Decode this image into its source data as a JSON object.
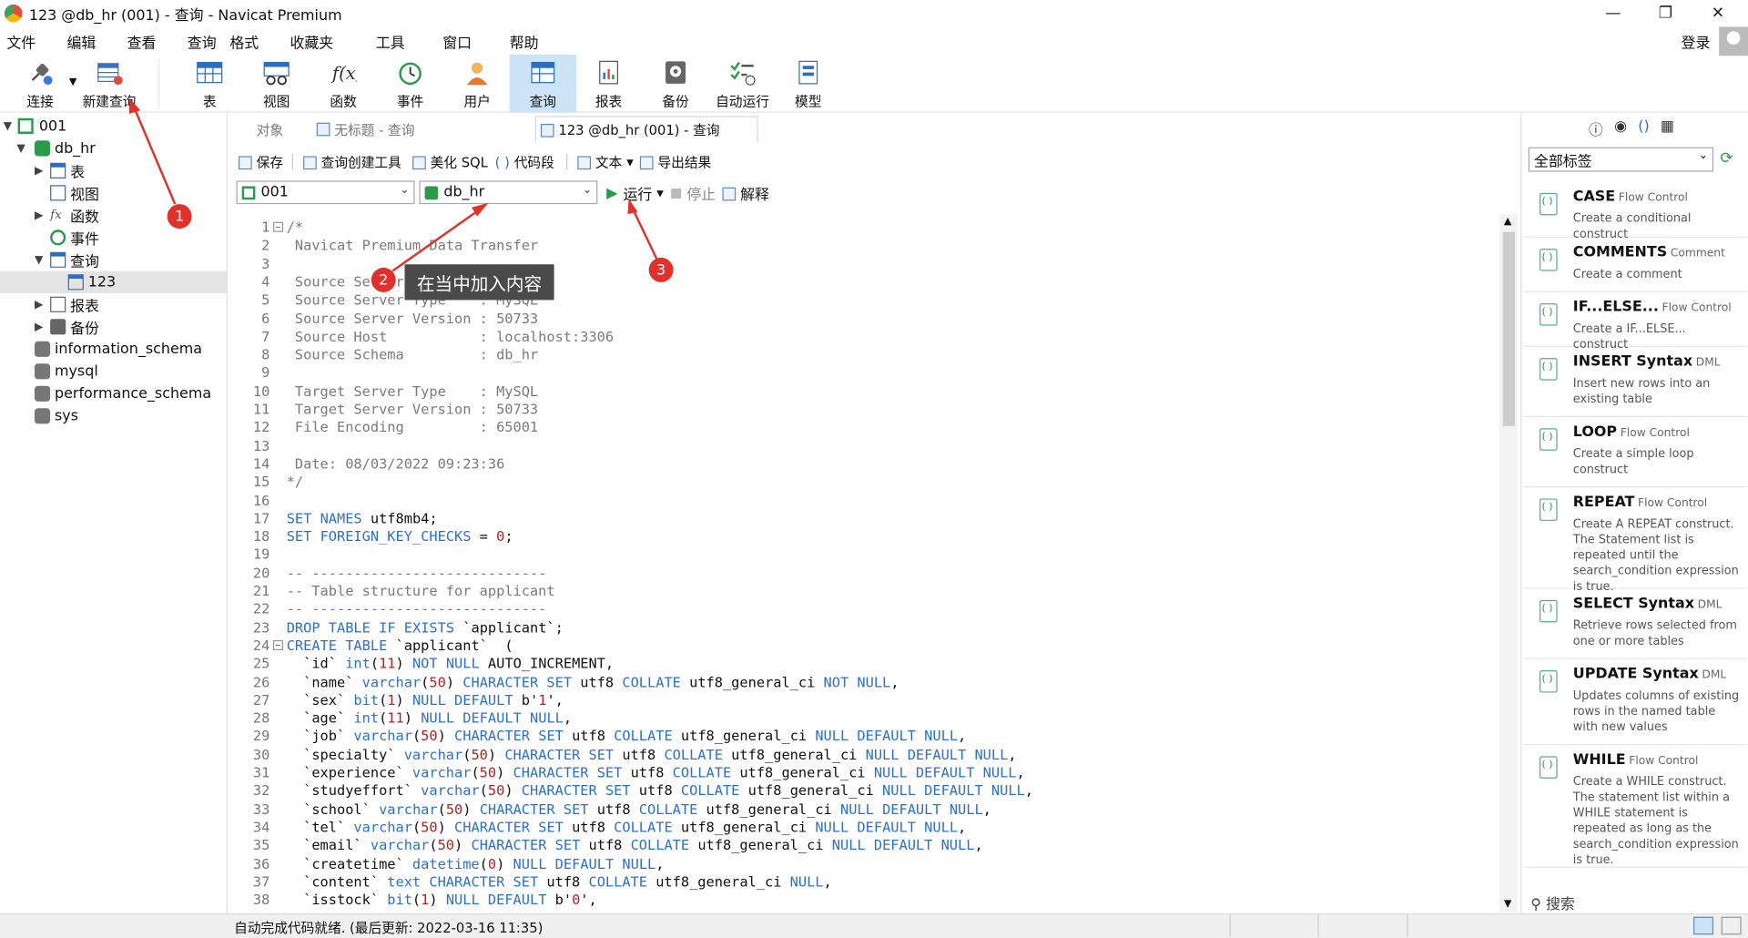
{
  "window": {
    "title": "123 @db_hr (001) - 查询 - Navicat Premium"
  },
  "menu": [
    "文件",
    "编辑",
    "查看",
    "查询",
    "格式",
    "收藏夹",
    "工具",
    "窗口",
    "帮助"
  ],
  "login": "登录",
  "toolbar": {
    "connect": "连接",
    "new_query": "新建查询",
    "table": "表",
    "view": "视图",
    "function": "函数",
    "event": "事件",
    "user": "用户",
    "query": "查询",
    "report": "报表",
    "backup": "备份",
    "automation": "自动运行",
    "model": "模型"
  },
  "tree": {
    "conn": "001",
    "db": "db_hr",
    "tables": "表",
    "views": "视图",
    "functions": "函数",
    "events": "事件",
    "queries": "查询",
    "query_item": "123",
    "reports": "报表",
    "backups": "备份",
    "db2": "information_schema",
    "db3": "mysql",
    "db4": "performance_schema",
    "db5": "sys"
  },
  "tabs": {
    "objects": "对象",
    "untitled": "无标题 - 查询",
    "current": "123 @db_hr (001) - 查询"
  },
  "query_toolbar": {
    "save": "保存",
    "builder": "查询创建工具",
    "beautify": "美化 SQL",
    "snippet": "代码段",
    "text": "文本",
    "export": "导出结果",
    "run": "运行",
    "stop": "停止",
    "explain": "解释"
  },
  "selectors": {
    "connection": "001",
    "database": "db_hr"
  },
  "editor": {
    "lines": [
      "/*",
      " Navicat Premium Data Transfer",
      "",
      " Source Server         : 001",
      " Source Server Type    : MySQL",
      " Source Server Version : 50733",
      " Source Host           : localhost:3306",
      " Source Schema         : db_hr",
      "",
      " Target Server Type    : MySQL",
      " Target Server Version : 50733",
      " File Encoding         : 65001",
      "",
      " Date: 08/03/2022 09:23:36",
      "*/",
      "",
      "SET NAMES utf8mb4;",
      "SET FOREIGN_KEY_CHECKS = 0;",
      "",
      "-- ----------------------------",
      "-- Table structure for applicant",
      "-- ----------------------------",
      "DROP TABLE IF EXISTS `applicant`;",
      "CREATE TABLE `applicant`  (",
      "  `id` int(11) NOT NULL AUTO_INCREMENT,",
      "  `name` varchar(50) CHARACTER SET utf8 COLLATE utf8_general_ci NOT NULL,",
      "  `sex` bit(1) NULL DEFAULT b'1',",
      "  `age` int(11) NULL DEFAULT NULL,",
      "  `job` varchar(50) CHARACTER SET utf8 COLLATE utf8_general_ci NULL DEFAULT NULL,",
      "  `specialty` varchar(50) CHARACTER SET utf8 COLLATE utf8_general_ci NULL DEFAULT NULL,",
      "  `experience` varchar(50) CHARACTER SET utf8 COLLATE utf8_general_ci NULL DEFAULT NULL,",
      "  `studyeffort` varchar(50) CHARACTER SET utf8 COLLATE utf8_general_ci NULL DEFAULT NULL,",
      "  `school` varchar(50) CHARACTER SET utf8 COLLATE utf8_general_ci NULL DEFAULT NULL,",
      "  `tel` varchar(50) CHARACTER SET utf8 COLLATE utf8_general_ci NULL DEFAULT NULL,",
      "  `email` varchar(50) CHARACTER SET utf8 COLLATE utf8_general_ci NULL DEFAULT NULL,",
      "  `createtime` datetime(0) NULL DEFAULT NULL,",
      "  `content` text CHARACTER SET utf8 COLLATE utf8_general_ci NULL,",
      "  `isstock` bit(1) NULL DEFAULT b'0',"
    ]
  },
  "snippets": {
    "filter": "全部标签",
    "items": [
      {
        "title": "CASE",
        "tag": "Flow Control",
        "desc": "Create a conditional construct"
      },
      {
        "title": "COMMENTS",
        "tag": "Comment",
        "desc": "Create a comment"
      },
      {
        "title": "IF...ELSE...",
        "tag": "Flow Control",
        "desc": "Create a IF...ELSE... construct"
      },
      {
        "title": "INSERT Syntax",
        "tag": "DML",
        "desc": "Insert new rows into an existing table"
      },
      {
        "title": "LOOP",
        "tag": "Flow Control",
        "desc": "Create a simple loop construct"
      },
      {
        "title": "REPEAT",
        "tag": "Flow Control",
        "desc": "Create A REPEAT construct. The Statement list is repeated until the search_condition expression is true."
      },
      {
        "title": "SELECT Syntax",
        "tag": "DML",
        "desc": "Retrieve rows selected from one or more tables"
      },
      {
        "title": "UPDATE Syntax",
        "tag": "DML",
        "desc": "Updates columns of existing rows in the named table with new values"
      },
      {
        "title": "WHILE",
        "tag": "Flow Control",
        "desc": "Create a WHILE construct. The statement list within a WHILE statement is repeated as long as the search_condition expression is true."
      }
    ],
    "search": "搜索"
  },
  "status": "自动完成代码就绪. (最后更新: 2022-03-16 11:35)",
  "annotations": {
    "m1": "1",
    "m2": "2",
    "m3": "3",
    "tooltip": "在当中加入内容"
  },
  "colors": {
    "accent": "#2a6fd6",
    "marker": "#e1312a",
    "active_tool": "#cde4f7"
  }
}
